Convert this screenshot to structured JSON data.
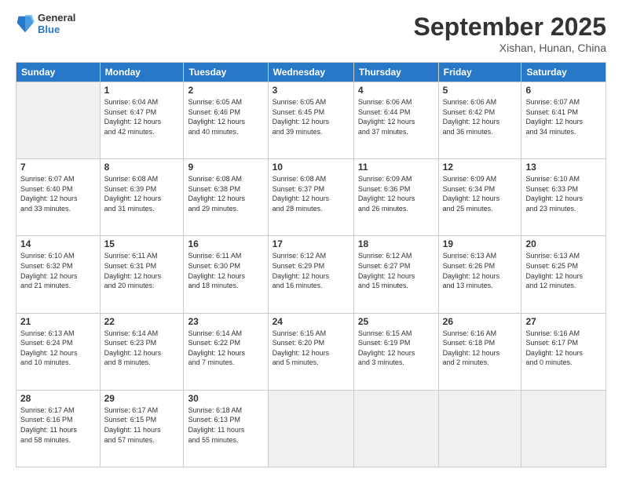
{
  "header": {
    "logo_general": "General",
    "logo_blue": "Blue",
    "title": "September 2025",
    "location": "Xishan, Hunan, China"
  },
  "days_of_week": [
    "Sunday",
    "Monday",
    "Tuesday",
    "Wednesday",
    "Thursday",
    "Friday",
    "Saturday"
  ],
  "weeks": [
    [
      {
        "num": "",
        "info": ""
      },
      {
        "num": "1",
        "info": "Sunrise: 6:04 AM\nSunset: 6:47 PM\nDaylight: 12 hours\nand 42 minutes."
      },
      {
        "num": "2",
        "info": "Sunrise: 6:05 AM\nSunset: 6:46 PM\nDaylight: 12 hours\nand 40 minutes."
      },
      {
        "num": "3",
        "info": "Sunrise: 6:05 AM\nSunset: 6:45 PM\nDaylight: 12 hours\nand 39 minutes."
      },
      {
        "num": "4",
        "info": "Sunrise: 6:06 AM\nSunset: 6:44 PM\nDaylight: 12 hours\nand 37 minutes."
      },
      {
        "num": "5",
        "info": "Sunrise: 6:06 AM\nSunset: 6:42 PM\nDaylight: 12 hours\nand 36 minutes."
      },
      {
        "num": "6",
        "info": "Sunrise: 6:07 AM\nSunset: 6:41 PM\nDaylight: 12 hours\nand 34 minutes."
      }
    ],
    [
      {
        "num": "7",
        "info": "Sunrise: 6:07 AM\nSunset: 6:40 PM\nDaylight: 12 hours\nand 33 minutes."
      },
      {
        "num": "8",
        "info": "Sunrise: 6:08 AM\nSunset: 6:39 PM\nDaylight: 12 hours\nand 31 minutes."
      },
      {
        "num": "9",
        "info": "Sunrise: 6:08 AM\nSunset: 6:38 PM\nDaylight: 12 hours\nand 29 minutes."
      },
      {
        "num": "10",
        "info": "Sunrise: 6:08 AM\nSunset: 6:37 PM\nDaylight: 12 hours\nand 28 minutes."
      },
      {
        "num": "11",
        "info": "Sunrise: 6:09 AM\nSunset: 6:36 PM\nDaylight: 12 hours\nand 26 minutes."
      },
      {
        "num": "12",
        "info": "Sunrise: 6:09 AM\nSunset: 6:34 PM\nDaylight: 12 hours\nand 25 minutes."
      },
      {
        "num": "13",
        "info": "Sunrise: 6:10 AM\nSunset: 6:33 PM\nDaylight: 12 hours\nand 23 minutes."
      }
    ],
    [
      {
        "num": "14",
        "info": "Sunrise: 6:10 AM\nSunset: 6:32 PM\nDaylight: 12 hours\nand 21 minutes."
      },
      {
        "num": "15",
        "info": "Sunrise: 6:11 AM\nSunset: 6:31 PM\nDaylight: 12 hours\nand 20 minutes."
      },
      {
        "num": "16",
        "info": "Sunrise: 6:11 AM\nSunset: 6:30 PM\nDaylight: 12 hours\nand 18 minutes."
      },
      {
        "num": "17",
        "info": "Sunrise: 6:12 AM\nSunset: 6:29 PM\nDaylight: 12 hours\nand 16 minutes."
      },
      {
        "num": "18",
        "info": "Sunrise: 6:12 AM\nSunset: 6:27 PM\nDaylight: 12 hours\nand 15 minutes."
      },
      {
        "num": "19",
        "info": "Sunrise: 6:13 AM\nSunset: 6:26 PM\nDaylight: 12 hours\nand 13 minutes."
      },
      {
        "num": "20",
        "info": "Sunrise: 6:13 AM\nSunset: 6:25 PM\nDaylight: 12 hours\nand 12 minutes."
      }
    ],
    [
      {
        "num": "21",
        "info": "Sunrise: 6:13 AM\nSunset: 6:24 PM\nDaylight: 12 hours\nand 10 minutes."
      },
      {
        "num": "22",
        "info": "Sunrise: 6:14 AM\nSunset: 6:23 PM\nDaylight: 12 hours\nand 8 minutes."
      },
      {
        "num": "23",
        "info": "Sunrise: 6:14 AM\nSunset: 6:22 PM\nDaylight: 12 hours\nand 7 minutes."
      },
      {
        "num": "24",
        "info": "Sunrise: 6:15 AM\nSunset: 6:20 PM\nDaylight: 12 hours\nand 5 minutes."
      },
      {
        "num": "25",
        "info": "Sunrise: 6:15 AM\nSunset: 6:19 PM\nDaylight: 12 hours\nand 3 minutes."
      },
      {
        "num": "26",
        "info": "Sunrise: 6:16 AM\nSunset: 6:18 PM\nDaylight: 12 hours\nand 2 minutes."
      },
      {
        "num": "27",
        "info": "Sunrise: 6:16 AM\nSunset: 6:17 PM\nDaylight: 12 hours\nand 0 minutes."
      }
    ],
    [
      {
        "num": "28",
        "info": "Sunrise: 6:17 AM\nSunset: 6:16 PM\nDaylight: 11 hours\nand 58 minutes."
      },
      {
        "num": "29",
        "info": "Sunrise: 6:17 AM\nSunset: 6:15 PM\nDaylight: 11 hours\nand 57 minutes."
      },
      {
        "num": "30",
        "info": "Sunrise: 6:18 AM\nSunset: 6:13 PM\nDaylight: 11 hours\nand 55 minutes."
      },
      {
        "num": "",
        "info": ""
      },
      {
        "num": "",
        "info": ""
      },
      {
        "num": "",
        "info": ""
      },
      {
        "num": "",
        "info": ""
      }
    ]
  ]
}
